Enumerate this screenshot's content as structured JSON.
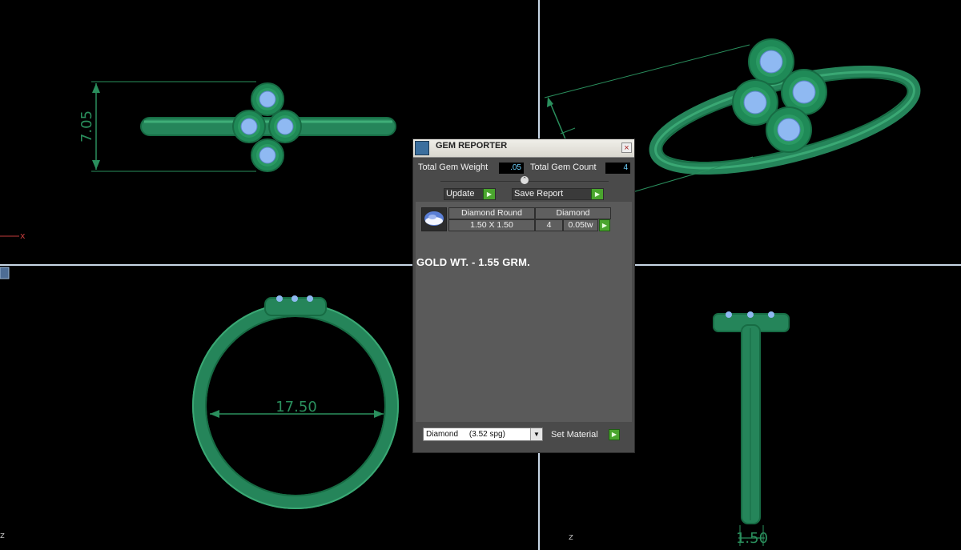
{
  "viewports": {
    "front_height_dimension": "7.05",
    "inner_diameter_dimension": "17.50",
    "side_width_dimension": "1.50",
    "axis_x": "x",
    "axis_z_left": "z",
    "axis_z_right": "z"
  },
  "gem_reporter": {
    "title": "GEM REPORTER",
    "close_glyph": "×",
    "total_weight_label": "Total Gem Weight",
    "total_weight_value": ".05",
    "total_count_label": "Total Gem Count",
    "total_count_value": "4",
    "collapse_glyph": "⌃",
    "update_label": "Update",
    "save_label": "Save Report",
    "go_glyph": "▶",
    "gems": [
      {
        "shape": "Diamond Round",
        "material": "Diamond",
        "size": "1.50 X 1.50",
        "count": "4",
        "weight": "0.05tw"
      }
    ],
    "note": "GOLD WT. - 1.55 GRM.",
    "material_select": "Diamond     (3.52 spg)",
    "dropdown_glyph": "▼",
    "set_material_label": "Set Material"
  },
  "colors": {
    "metal": "#25855a",
    "gem": "#8fb9f2",
    "viewport_line": "#c8d7e6"
  }
}
